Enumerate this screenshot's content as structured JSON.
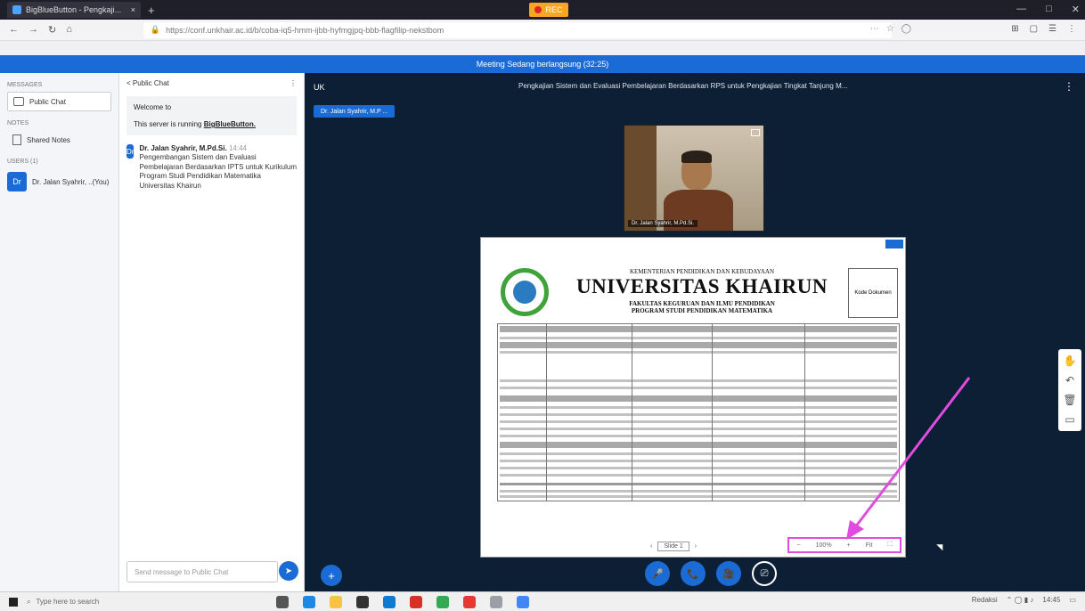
{
  "browser": {
    "tab_title": "BigBlueButton - Pengkaji...",
    "tab_close": "×",
    "new_tab": "+",
    "rec_label": "REC",
    "win_controls": [
      "—",
      "□",
      "✕"
    ],
    "nav_icons": [
      "←",
      "→",
      "↻",
      "⌂"
    ],
    "url": "https://conf.unkhair.ac.id/b/coba-iq5-hmm-ijbb-hyfmgjpq-bbb-flagfilip-nekstbom",
    "addr_right": [
      "⋯",
      "☆",
      "◯"
    ],
    "addr_tools": [
      "⊞",
      "▢",
      "☰",
      "⋮"
    ]
  },
  "banner": {
    "text": "Meeting Sedang berlangsung (32:25)"
  },
  "rail": {
    "messages_header": "MESSAGES",
    "public_chat": "Public Chat",
    "notes_header": "NOTES",
    "shared_notes": "Shared Notes",
    "users_header": "USERS (1)",
    "user_name": "Dr. Jalan Syahrir, ..(You)",
    "user_initial": "Dr"
  },
  "chat": {
    "header": "< Public Chat",
    "menu": "⋮",
    "welcome_title": "Welcome to",
    "welcome_text": "This server is running",
    "welcome_link": "BigBlueButton.",
    "msg_initial": "Dr",
    "msg_name": "Dr. Jalan Syahrir, M.Pd.Si.",
    "msg_time": "14:44",
    "msg_text": "Pengembangan Sistem dan Evaluasi Pembelajaran Berdasarkan IPTS untuk Kurikulum Program Studi Pendidikan Matematika Universitas Khairun",
    "input_placeholder": "Send message to Public Chat",
    "send_icon": "➤"
  },
  "stage": {
    "back_label": "UK",
    "title": "Pengkajian Sistem dan Evaluasi Pembelajaran Berdasarkan RPS untuk Pengkajian Tingkat Tanjung M...",
    "kebab": "⋮",
    "presenter_label": "Dr. Jalan Syahrir, M.P ...",
    "webcam_label": "Dr. Jalan Syahrir, M.Pd.Si.",
    "slide": {
      "ministry": "KEMENTERIAN PENDIDIKAN DAN KEBUDAYAAN",
      "university": "UNIVERSITAS KHAIRUN",
      "faculty": "FAKULTAS KEGURUAN DAN ILMU PENDIDIKAN",
      "program": "PROGRAM STUDI PENDIDIKAN MATEMATIKA",
      "box_text": "Kode Dokumen",
      "nav_prev": "‹",
      "nav_slide": "Slide 1",
      "nav_next": "›",
      "zoom_minus": "−",
      "zoom_value": "100%",
      "zoom_plus": "+",
      "zoom_fit": "Fit",
      "fullscreen": "⛶"
    },
    "tools": [
      "✋",
      "↶",
      "🗑",
      "▭"
    ],
    "fab_plus": "+",
    "controls": [
      "🎤",
      "📞",
      "🎥",
      "⎚"
    ]
  },
  "taskbar": {
    "search_placeholder": "Type here to search",
    "tray_text": "Redaksi",
    "clock": "14:45"
  },
  "colors": {
    "banner": "#1b6bd6",
    "stage_bg": "#0d1f35",
    "annotation": "#e04ce0"
  }
}
